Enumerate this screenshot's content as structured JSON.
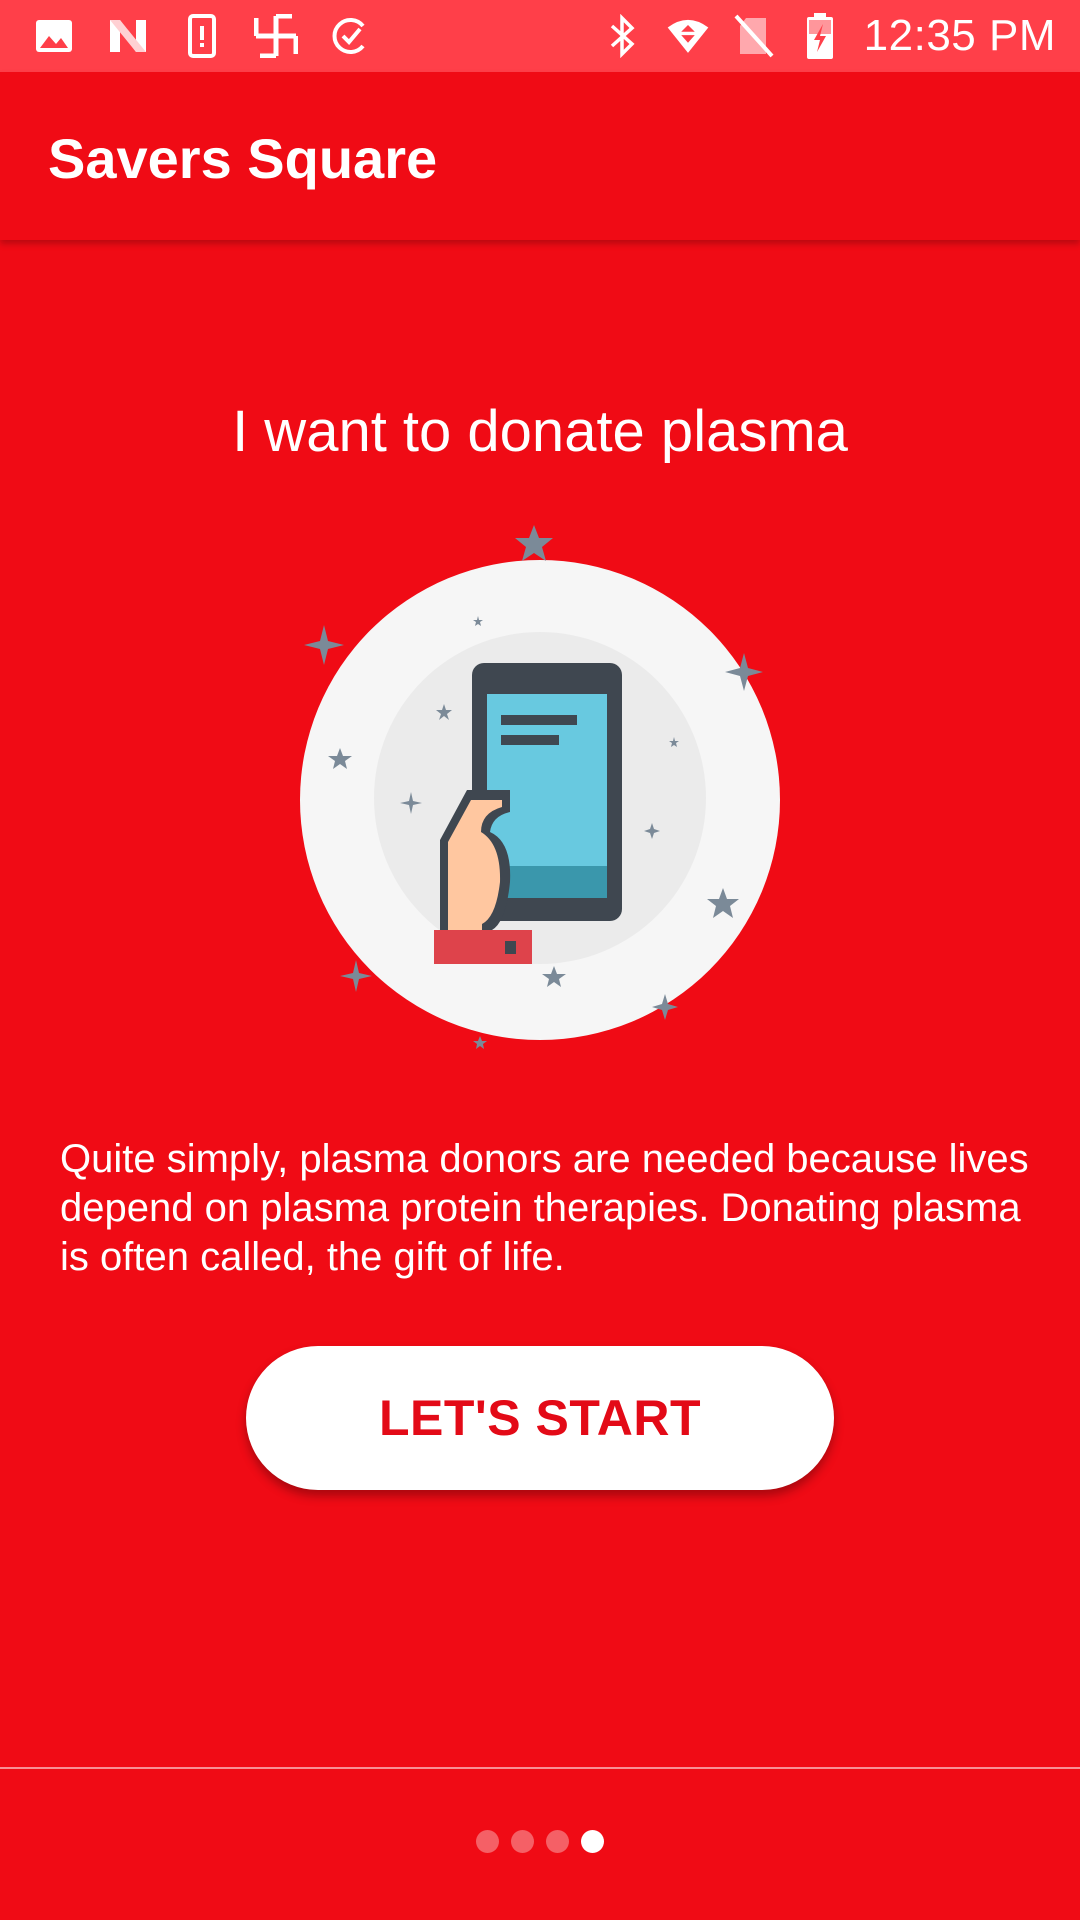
{
  "status_bar": {
    "time": "12:35 PM",
    "left_icons": [
      "image-icon",
      "n-logo-icon",
      "device-alert-icon",
      "app-glyph-icon",
      "c-logo-icon"
    ],
    "right_icons": [
      "bluetooth-icon",
      "wifi-icon",
      "no-sim-icon",
      "battery-charging-icon"
    ]
  },
  "app_bar": {
    "title": "Savers Square"
  },
  "onboarding": {
    "headline": "I want to donate plasma",
    "illustration": "hand-holding-phone-icon",
    "description": "Quite simply, plasma donors are needed because lives depend on plasma protein therapies. Donating plasma is often called, the gift of life.",
    "start_button": "LET'S START",
    "page_count": 4,
    "current_page": 4
  },
  "colors": {
    "primary": "#F00B15",
    "status_bar": "#FF3F49",
    "button_text": "#E30A17",
    "screen_blue": "#68C9E0",
    "star_gray": "#7B8A98"
  }
}
